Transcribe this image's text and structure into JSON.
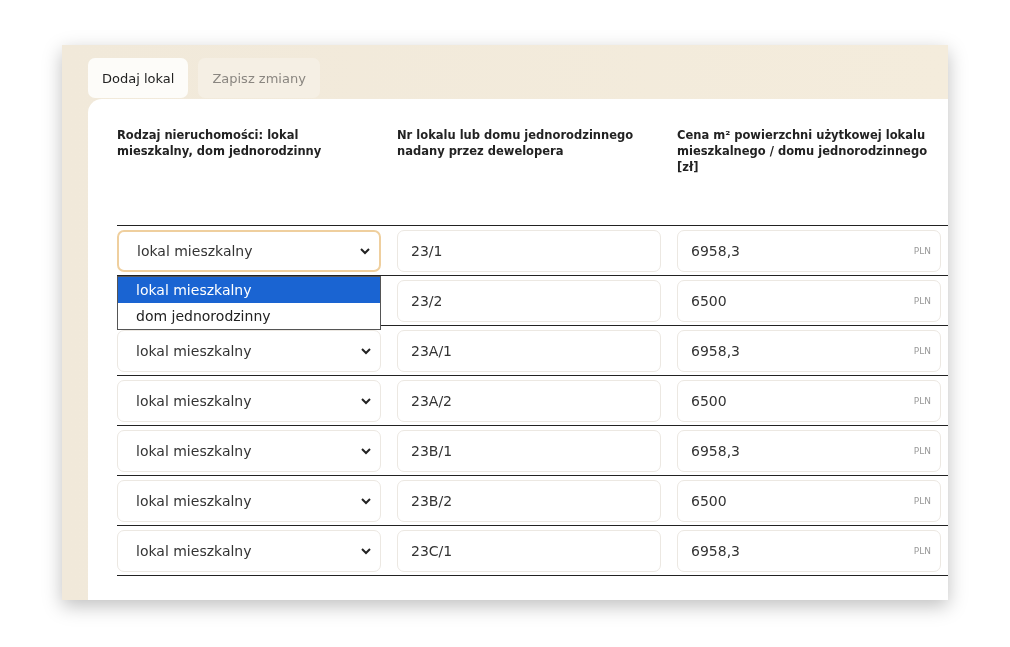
{
  "toolbar": {
    "buttons": [
      {
        "label": "Dodaj lokal",
        "disabled": false
      },
      {
        "label": "Zapisz zmiany",
        "disabled": true
      }
    ]
  },
  "table": {
    "columns": [
      "Rodzaj nieruchomości: lokal mieszkalny, dom jednorodzinny",
      "Nr lokalu lub domu jednorodzinnego nadany przez dewelopera",
      "Cena m² powierzchni użytkowej lokalu mieszkalnego / domu jednorodzinnego [zł]"
    ],
    "rows": [
      {
        "type": "lokal mieszkalny",
        "focused": true,
        "number": "23/1",
        "price": "6958,3",
        "currency": "PLN"
      },
      {
        "number": "23/2",
        "price": "6500",
        "currency": "PLN"
      },
      {
        "type": "lokal mieszkalny",
        "focused": false,
        "number": "23A/1",
        "price": "6958,3",
        "currency": "PLN"
      },
      {
        "type": "lokal mieszkalny",
        "focused": false,
        "number": "23A/2",
        "price": "6500",
        "currency": "PLN"
      },
      {
        "type": "lokal mieszkalny",
        "focused": false,
        "number": "23B/1",
        "price": "6958,3",
        "currency": "PLN"
      },
      {
        "type": "lokal mieszkalny",
        "focused": false,
        "number": "23B/2",
        "price": "6500",
        "currency": "PLN"
      },
      {
        "type": "lokal mieszkalny",
        "focused": false,
        "number": "23C/1",
        "price": "6958,3",
        "currency": "PLN"
      }
    ]
  },
  "dropdown": {
    "options": [
      {
        "label": "lokal mieszkalny",
        "selected": true
      },
      {
        "label": "dom jednorodzinny",
        "selected": false
      }
    ]
  }
}
